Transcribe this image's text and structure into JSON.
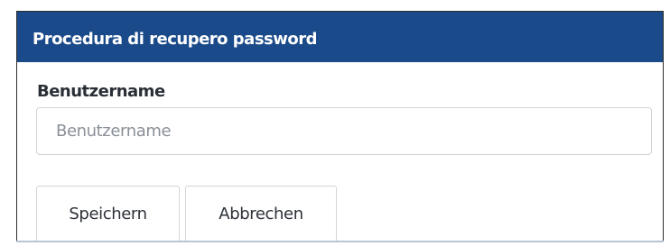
{
  "panel": {
    "title": "Procedura di recupero password"
  },
  "form": {
    "username_label": "Benutzername",
    "username_value": "",
    "username_placeholder": "Benutzername"
  },
  "actions": {
    "save_label": "Speichern",
    "cancel_label": "Abbrechen"
  },
  "colors": {
    "header_background": "#1b4a8a",
    "header_text": "#ffffff"
  }
}
